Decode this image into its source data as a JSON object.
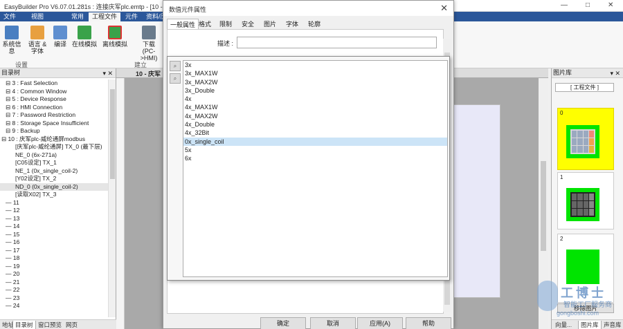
{
  "app": {
    "title": "EasyBuilder Pro V6.07.01.281s : 连接庆军plc.emtp - [10 -",
    "window_controls": [
      "—",
      "□",
      "✕"
    ]
  },
  "ribbon": {
    "tabs": [
      "文件",
      "视图",
      "常用",
      "工程文件",
      "元件",
      "资料/历"
    ],
    "active_tab": 3,
    "buttons": [
      {
        "label": "系统信息"
      },
      {
        "label": "语言 & 字体"
      },
      {
        "label": "编译"
      },
      {
        "label": "在线模拟"
      },
      {
        "label": "离线模拟"
      },
      {
        "label": "下载 (PC->HMI)"
      }
    ],
    "groups": [
      "设置",
      "建立"
    ]
  },
  "left_panel": {
    "title": "目录树",
    "controls": "▾ ✕",
    "tree": [
      {
        "text": "⊟ 3 : Fast Selection",
        "indent": 1
      },
      {
        "text": "⊟ 4 : Common Window",
        "indent": 1
      },
      {
        "text": "⊟ 5 : Device Response",
        "indent": 1
      },
      {
        "text": "⊟ 6 : HMI Connection",
        "indent": 1
      },
      {
        "text": "⊟ 7 : Password Restriction",
        "indent": 1
      },
      {
        "text": "⊟ 8 : Storage Space Insufficient",
        "indent": 1
      },
      {
        "text": "⊟ 9 : Backup",
        "indent": 1
      },
      {
        "text": "⊟ 10 : 庆军plc-威纶通屏modbus",
        "indent": 0
      },
      {
        "text": "[庆军plc-威纶通屏] TX_0 (最下层)",
        "indent": 2
      },
      {
        "text": "NE_0 (6x-271a)",
        "indent": 2
      },
      {
        "text": "[C05设定] TX_1",
        "indent": 2
      },
      {
        "text": "NE_1 (0x_single_coil-2)",
        "indent": 2
      },
      {
        "text": "[Y02设定] TX_2",
        "indent": 2
      },
      {
        "text": "ND_0 (0x_single_coil-2)",
        "indent": 2,
        "selected": true
      },
      {
        "text": "[读取X02] TX_3",
        "indent": 2
      },
      {
        "text": "— 11",
        "indent": 1
      },
      {
        "text": "— 12",
        "indent": 1
      },
      {
        "text": "— 13",
        "indent": 1
      },
      {
        "text": "— 14",
        "indent": 1
      },
      {
        "text": "— 15",
        "indent": 1
      },
      {
        "text": "— 16",
        "indent": 1
      },
      {
        "text": "— 17",
        "indent": 1
      },
      {
        "text": "— 18",
        "indent": 1
      },
      {
        "text": "— 19",
        "indent": 1
      },
      {
        "text": "— 20",
        "indent": 1
      },
      {
        "text": "— 21",
        "indent": 1
      },
      {
        "text": "— 22",
        "indent": 1
      },
      {
        "text": "— 23",
        "indent": 1
      },
      {
        "text": "— 24",
        "indent": 1
      }
    ],
    "bottom_tabs": [
      "地址",
      "目录树",
      "窗口预览",
      "网页"
    ],
    "active_bottom_tab": 1
  },
  "editor": {
    "tab_label": "10 - 庆军"
  },
  "right_panel": {
    "title": "图片库",
    "controls": "▾ ✕",
    "combo": "[ 工程文件 ]",
    "items": [
      "0",
      "1",
      "2"
    ],
    "remove_button": "移除图片",
    "bottom_tabs": [
      "向量...",
      "图片库",
      "声音库"
    ],
    "active_bottom_tab": 1
  },
  "dialog": {
    "title": "数值元件属性",
    "close": "✕",
    "tabs": [
      "一般属性",
      "格式",
      "限制",
      "安全",
      "图片",
      "字体",
      "轮廓"
    ],
    "active_tab": 0,
    "description_label": "描述 :",
    "description_value": "",
    "buttons": [
      "确定",
      "取消",
      "应用(A)",
      "帮助"
    ]
  },
  "address_popup": {
    "side_buttons": [
      "⌕",
      "⌕"
    ],
    "options": [
      "3x",
      "3x_MAX1W",
      "3x_MAX2W",
      "3x_Double",
      "4x",
      "4x_MAX1W",
      "4x_MAX2W",
      "4x_Double",
      "4x_32Bit",
      "0x_single_coil",
      "5x",
      "6x"
    ],
    "selected_index": 9
  },
  "watermark": {
    "big": "工博士",
    "small": "智能工厂服务商",
    "url": "gongboshi.com"
  }
}
